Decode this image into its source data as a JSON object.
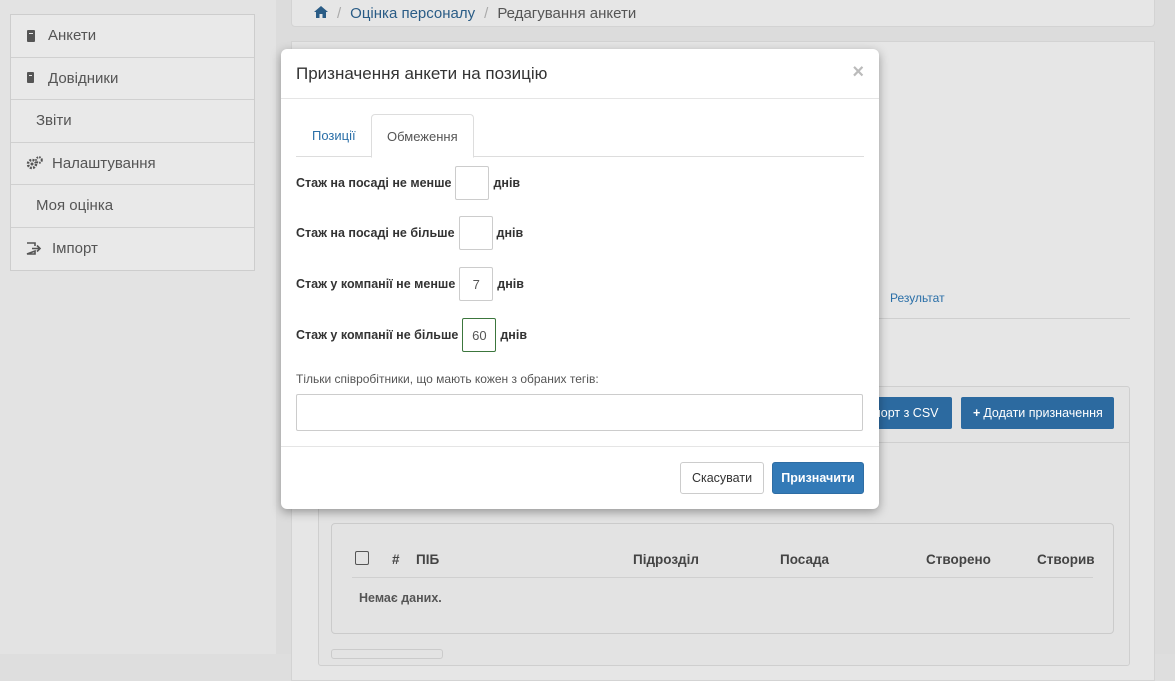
{
  "sidebar": {
    "items": [
      {
        "label": "Анкети",
        "icon": "book-icon"
      },
      {
        "label": "Довідники",
        "icon": "book-icon"
      },
      {
        "label": "Звіти",
        "icon": ""
      },
      {
        "label": "Налаштування",
        "icon": "gears-icon"
      },
      {
        "label": "Моя оцінка",
        "icon": ""
      },
      {
        "label": "Імпорт",
        "icon": "import-icon"
      }
    ]
  },
  "breadcrumb": {
    "home_icon": "home-icon",
    "link": "Оцінка персоналу",
    "current": "Редагування анкети"
  },
  "background": {
    "tab_result": "Результат",
    "import_csv_button": "порт з CSV",
    "add_assignment_button": "Додати призначення",
    "table": {
      "columns": [
        "#",
        "ПІБ",
        "Підрозділ",
        "Посада",
        "Створено",
        "Створив"
      ],
      "empty_text": "Немає даних."
    }
  },
  "modal": {
    "title": "Призначення анкети на позицію",
    "close": "×",
    "tabs": [
      {
        "label": "Позиції",
        "active": false
      },
      {
        "label": "Обмеження",
        "active": true
      }
    ],
    "fields": [
      {
        "label": "Стаж на посаді не менше",
        "value": "",
        "unit": "днів"
      },
      {
        "label": "Стаж на посаді не більше",
        "value": "",
        "unit": "днів"
      },
      {
        "label": "Стаж у компанії не менше",
        "value": "7",
        "unit": "днів"
      },
      {
        "label": "Стаж у компанії не більше",
        "value": "60",
        "unit": "днів"
      }
    ],
    "tags_label": "Тільки співробітники, що мають кожен з обраних тегів:",
    "tags_value": "",
    "cancel_label": "Скасувати",
    "assign_label": "Призначити"
  },
  "colors": {
    "primary": "#337ab7",
    "link": "#2a6fa8",
    "focus_border": "#3c763d"
  }
}
